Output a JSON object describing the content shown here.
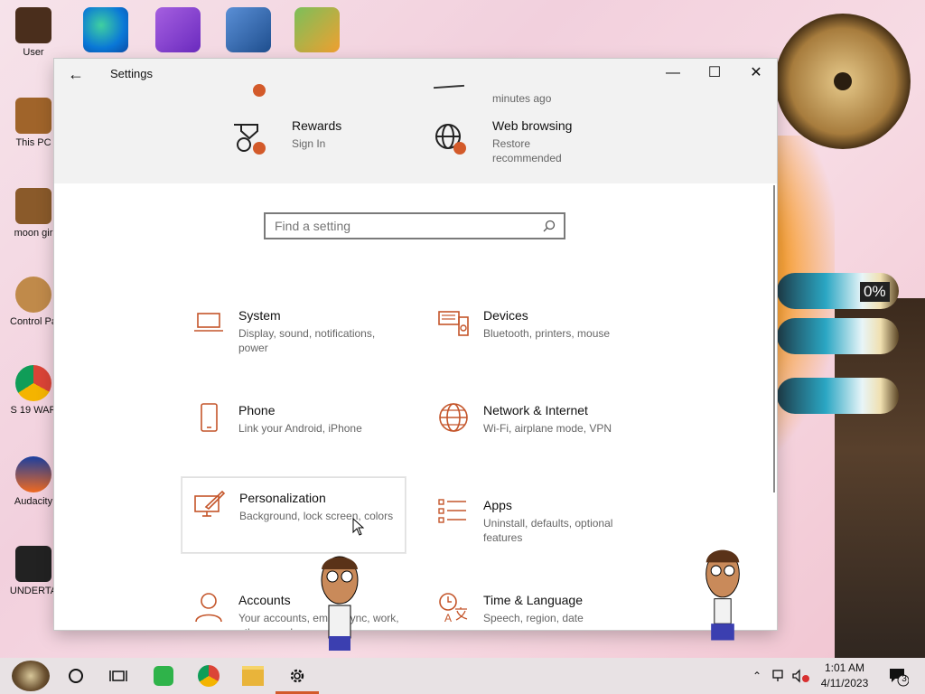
{
  "window": {
    "title": "Settings",
    "back_icon": "arrow-left-icon",
    "controls": {
      "minimize": "—",
      "maximize": "☐",
      "close": "✕"
    }
  },
  "banner": {
    "partial_top_text": "minutes ago",
    "items": [
      {
        "title": "Rewards",
        "subtitle": "Sign In",
        "icon": "rewards-icon"
      },
      {
        "title": "Web browsing",
        "subtitle_line1": "Restore",
        "subtitle_line2": "recommended",
        "icon": "globe-icon"
      }
    ]
  },
  "search": {
    "placeholder": "Find a setting",
    "icon": "search-icon"
  },
  "categories": [
    {
      "title": "System",
      "subtitle": "Display, sound, notifications, power",
      "icon": "laptop-icon"
    },
    {
      "title": "Devices",
      "subtitle": "Bluetooth, printers, mouse",
      "icon": "devices-icon"
    },
    {
      "title": "Phone",
      "subtitle": "Link your Android, iPhone",
      "icon": "phone-icon"
    },
    {
      "title": "Network & Internet",
      "subtitle": "Wi-Fi, airplane mode, VPN",
      "icon": "globe-icon"
    },
    {
      "title": "Personalization",
      "subtitle": "Background, lock screen, colors",
      "icon": "personalization-icon"
    },
    {
      "title": "Apps",
      "subtitle": "Uninstall, defaults, optional features",
      "icon": "apps-list-icon"
    },
    {
      "title": "Accounts",
      "subtitle": "Your accounts, email, sync, work, other people",
      "icon": "person-icon"
    },
    {
      "title": "Time & Language",
      "subtitle": "Speech, region, date",
      "icon": "time-language-icon"
    }
  ],
  "desktop": {
    "icons": [
      {
        "label": "User"
      },
      {
        "label": "This PC"
      },
      {
        "label": "moon gir"
      },
      {
        "label": "Control Pa"
      },
      {
        "label": "S 19 WAR"
      },
      {
        "label": "Audacity"
      },
      {
        "label": "UNDERTA"
      }
    ],
    "gauge_label": "0%"
  },
  "taskbar": {
    "time": "1:01 AM",
    "date": "4/11/2023",
    "notification_count": "3",
    "accent": "#d35a2a"
  },
  "colors": {
    "accent": "#d35a2a",
    "window_bg": "#ffffff",
    "banner_bg": "#f2f2f2"
  }
}
